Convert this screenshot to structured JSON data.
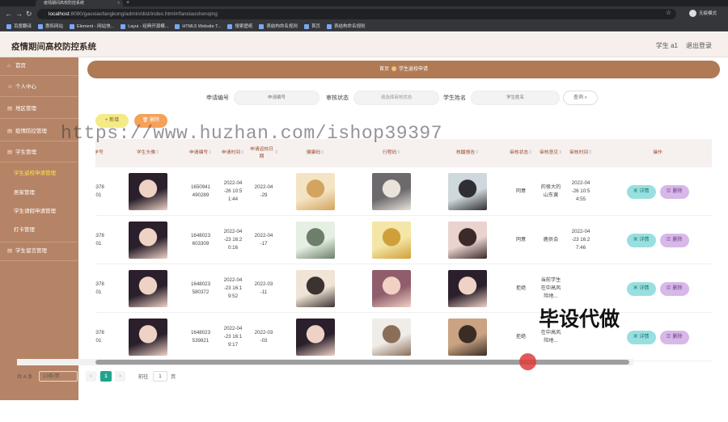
{
  "browser": {
    "tab_title": "疫情期间高校防控系统",
    "url_host": "localhost",
    "url_rest": ":8080/gaoxiaofangkong/admin/dist/index.html#/fanxiaoshenqing",
    "profile_label": "无痕模式",
    "bookmarks": [
      "百度翻译",
      "惠拓网站",
      "Element - 网站快...",
      "Layui - 经典开源模...",
      "HTML5 Website T...",
      "搜索壁纸",
      "表结构命名规则",
      "首页",
      "表结构命名规则"
    ]
  },
  "header": {
    "title": "疫情期间高校防控系统",
    "user": "学生 a1",
    "logout": "退出登录"
  },
  "sidebar": {
    "items": [
      {
        "label": "首页"
      },
      {
        "label": "个人中心"
      },
      {
        "label": "地区管理"
      },
      {
        "label": "疫情防控管理"
      },
      {
        "label": "学生管理"
      },
      {
        "label": "学生返校申请管理"
      },
      {
        "label": "居家管理"
      },
      {
        "label": "学生请假申请管理"
      },
      {
        "label": "打卡管理"
      },
      {
        "label": "学生留言管理"
      }
    ]
  },
  "breadcrumb": {
    "home": "首页",
    "current": "学生返校申请"
  },
  "search": {
    "label_no": "申请编号",
    "placeholder_no": "申请编号",
    "label_status": "审核状态",
    "placeholder_status": "请选择审核状态",
    "label_name": "学生姓名",
    "placeholder_name": "学生姓名",
    "button": "查询"
  },
  "actions": {
    "add": "+ 新增",
    "delete": "删除"
  },
  "watermark": "https://www.huzhan.com/ishop39397",
  "overlay_text": "毕设代做",
  "table": {
    "headers": [
      "学号",
      "学生头像",
      "申请编号",
      "申请时间",
      "申请返校日期",
      "健康码",
      "行程码",
      "核酸报告",
      "审核状态",
      "审核意见",
      "审核时间",
      "操作"
    ],
    "rows": [
      {
        "id": "8378\n01",
        "no": "1650941\n490289",
        "time": "2022-04\n-26 10:5\n1:44",
        "date": "2022-04\n-29",
        "status": "同意",
        "opinion": "的很大的\n山东黄",
        "review_time": "2022-04\n-26 10:5\n4:55"
      },
      {
        "id": "8378\n01",
        "no": "1648023\n603309",
        "time": "2022-04\n-23 16:2\n0:16",
        "date": "2022-04\n-17",
        "status": "同意",
        "opinion": "鹿员会",
        "review_time": "2022-04\n-23 16:2\n7:46"
      },
      {
        "id": "8378\n01",
        "no": "1648023\n580372",
        "time": "2022-04\n-23 16:1\n9:52",
        "date": "2022-03\n-11",
        "status": "拒绝",
        "opinion": "当前学生\n在中高风\n险地...",
        "review_time": ""
      },
      {
        "id": "8378\n01",
        "no": "1648023\n539821",
        "time": "2022-04\n-23 16:1\n9:17",
        "date": "2022-03\n-03",
        "status": "拒绝",
        "opinion": "在中高风\n险地...",
        "review_time": ""
      }
    ],
    "detail_label": "详情",
    "delete_label": "删除"
  },
  "pagination": {
    "total": "共 4 条",
    "page_size": "10条/页",
    "prev": "<",
    "current_page": "1",
    "next": ">",
    "goto_label": "前往",
    "goto_value": "1",
    "goto_suffix": "页"
  }
}
